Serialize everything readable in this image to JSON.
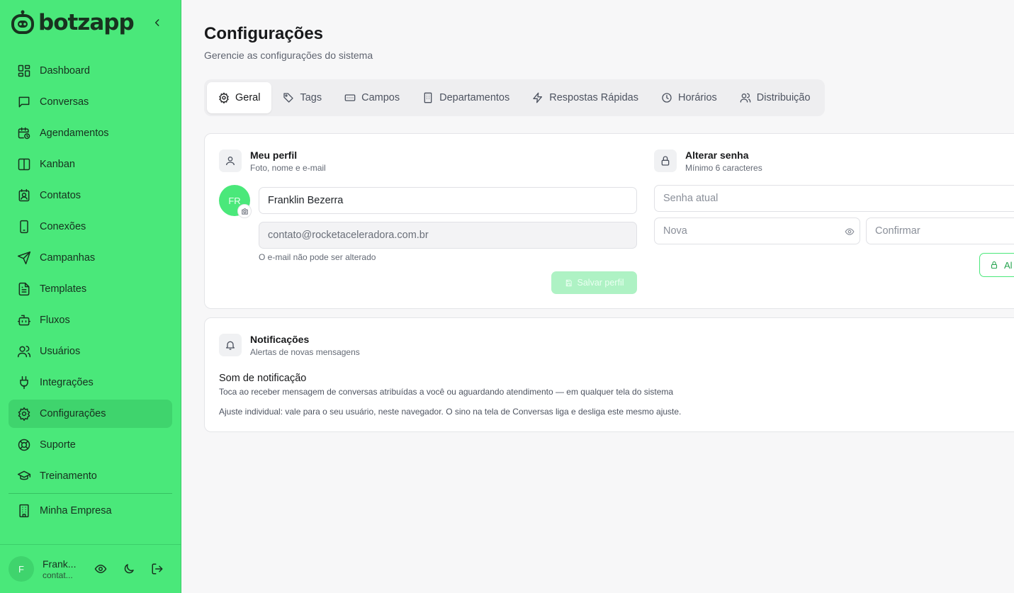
{
  "brand": {
    "name": "botzapp"
  },
  "sidebar": {
    "items": [
      {
        "label": "Dashboard",
        "icon": "dashboard-icon"
      },
      {
        "label": "Conversas",
        "icon": "chat-icon"
      },
      {
        "label": "Agendamentos",
        "icon": "calendar-clock-icon"
      },
      {
        "label": "Kanban",
        "icon": "kanban-icon"
      },
      {
        "label": "Contatos",
        "icon": "contact-card-icon"
      },
      {
        "label": "Conexões",
        "icon": "phone-icon"
      },
      {
        "label": "Campanhas",
        "icon": "send-icon"
      },
      {
        "label": "Templates",
        "icon": "file-text-icon"
      },
      {
        "label": "Fluxos",
        "icon": "bot-icon"
      },
      {
        "label": "Usuários",
        "icon": "users-icon"
      },
      {
        "label": "Integrações",
        "icon": "plug-icon"
      },
      {
        "label": "Configurações",
        "icon": "gear-icon",
        "active": true
      },
      {
        "label": "Suporte",
        "icon": "lifebuoy-icon"
      },
      {
        "label": "Treinamento",
        "icon": "graduation-cap-icon"
      }
    ],
    "extra": {
      "label": "Minha Empresa",
      "icon": "building-icon"
    },
    "user": {
      "initial": "F",
      "name": "Frank...",
      "email": "contat..."
    }
  },
  "page": {
    "title": "Configurações",
    "subtitle": "Gerencie as configurações do sistema"
  },
  "tabs": [
    {
      "label": "Geral",
      "icon": "gear-icon",
      "active": true
    },
    {
      "label": "Tags",
      "icon": "tag-icon"
    },
    {
      "label": "Campos",
      "icon": "input-field-icon"
    },
    {
      "label": "Departamentos",
      "icon": "building-icon"
    },
    {
      "label": "Respostas Rápidas",
      "icon": "bolt-icon"
    },
    {
      "label": "Horários",
      "icon": "clock-icon"
    },
    {
      "label": "Distribuição",
      "icon": "users-icon"
    }
  ],
  "profile": {
    "title": "Meu perfil",
    "subtitle": "Foto, nome e e-mail",
    "avatar_initials": "FR",
    "name_value": "Franklin Bezerra",
    "email_value": "contato@rocketaceleradora.com.br",
    "email_hint": "O e-mail não pode ser alterado",
    "save_label": "Salvar perfil"
  },
  "password": {
    "title": "Alterar senha",
    "subtitle": "Mínimo 6 caracteres",
    "current_placeholder": "Senha atual",
    "new_placeholder": "Nova",
    "confirm_placeholder": "Confirmar",
    "button_label": "Al"
  },
  "notifications": {
    "title": "Notificações",
    "subtitle": "Alertas de novas mensagens",
    "sound_title": "Som de notificação",
    "sound_desc": "Toca ao receber mensagem de conversas atribuídas a você ou aguardando atendimento — em qualquer tela do sistema",
    "individual_note": "Ajuste individual: vale para o seu usuário, neste navegador. O sino na tela de Conversas liga e desliga este mesmo ajuste."
  },
  "colors": {
    "sidebar_bg": "#4ae87a",
    "accent": "#4ae87a",
    "active_item": "#3fd46d"
  }
}
